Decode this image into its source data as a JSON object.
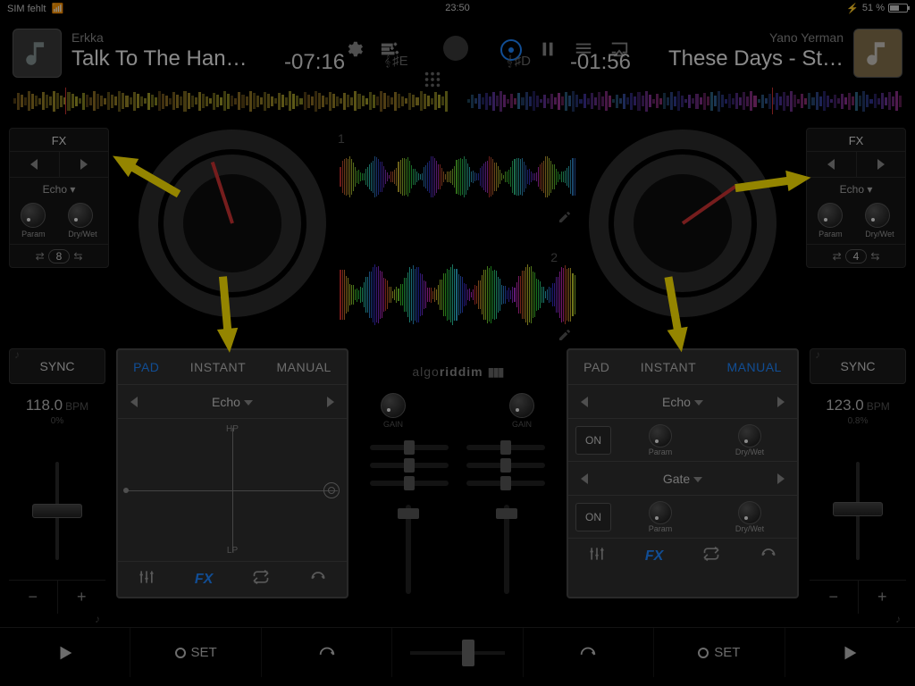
{
  "status": {
    "left": "SIM fehlt",
    "time": "23:50",
    "battery_pct": "51 %"
  },
  "deckA": {
    "artist": "Erkka",
    "title": "Talk To The Han…",
    "remain": "-07:16",
    "key": "♯E",
    "num": "1"
  },
  "deckB": {
    "artist": "Yano Yerman",
    "title": "These Days - St…",
    "remain": "-01:56",
    "key": "♯D",
    "num": "2"
  },
  "fxA": {
    "title": "FX",
    "effect": "Echo ▾",
    "param": "Param",
    "drywet": "Dry/Wet",
    "loop": "8"
  },
  "fxB": {
    "title": "FX",
    "effect": "Echo ▾",
    "param": "Param",
    "drywet": "Dry/Wet",
    "loop": "4"
  },
  "syncA": {
    "label": "SYNC",
    "bpm": "118.0",
    "bpm_unit": "BPM",
    "pct": "0%"
  },
  "syncB": {
    "label": "SYNC",
    "bpm": "123.0",
    "bpm_unit": "BPM",
    "pct": "0.8%"
  },
  "panelA": {
    "tabs": {
      "pad": "PAD",
      "instant": "INSTANT",
      "manual": "MANUAL",
      "active": "pad"
    },
    "effect": "Echo",
    "hp": "HP",
    "lp": "LP",
    "footer_fx": "FX"
  },
  "panelB": {
    "tabs": {
      "pad": "PAD",
      "instant": "INSTANT",
      "manual": "MANUAL",
      "active": "manual"
    },
    "slot1": {
      "effect": "Echo",
      "on": "ON",
      "param": "Param",
      "drywet": "Dry/Wet"
    },
    "slot2": {
      "effect": "Gate",
      "on": "ON",
      "param": "Param",
      "drywet": "Dry/Wet"
    },
    "footer_fx": "FX"
  },
  "mixer": {
    "brand": "algoriddim",
    "gain": "GAIN"
  },
  "transport": {
    "set": "SET"
  }
}
